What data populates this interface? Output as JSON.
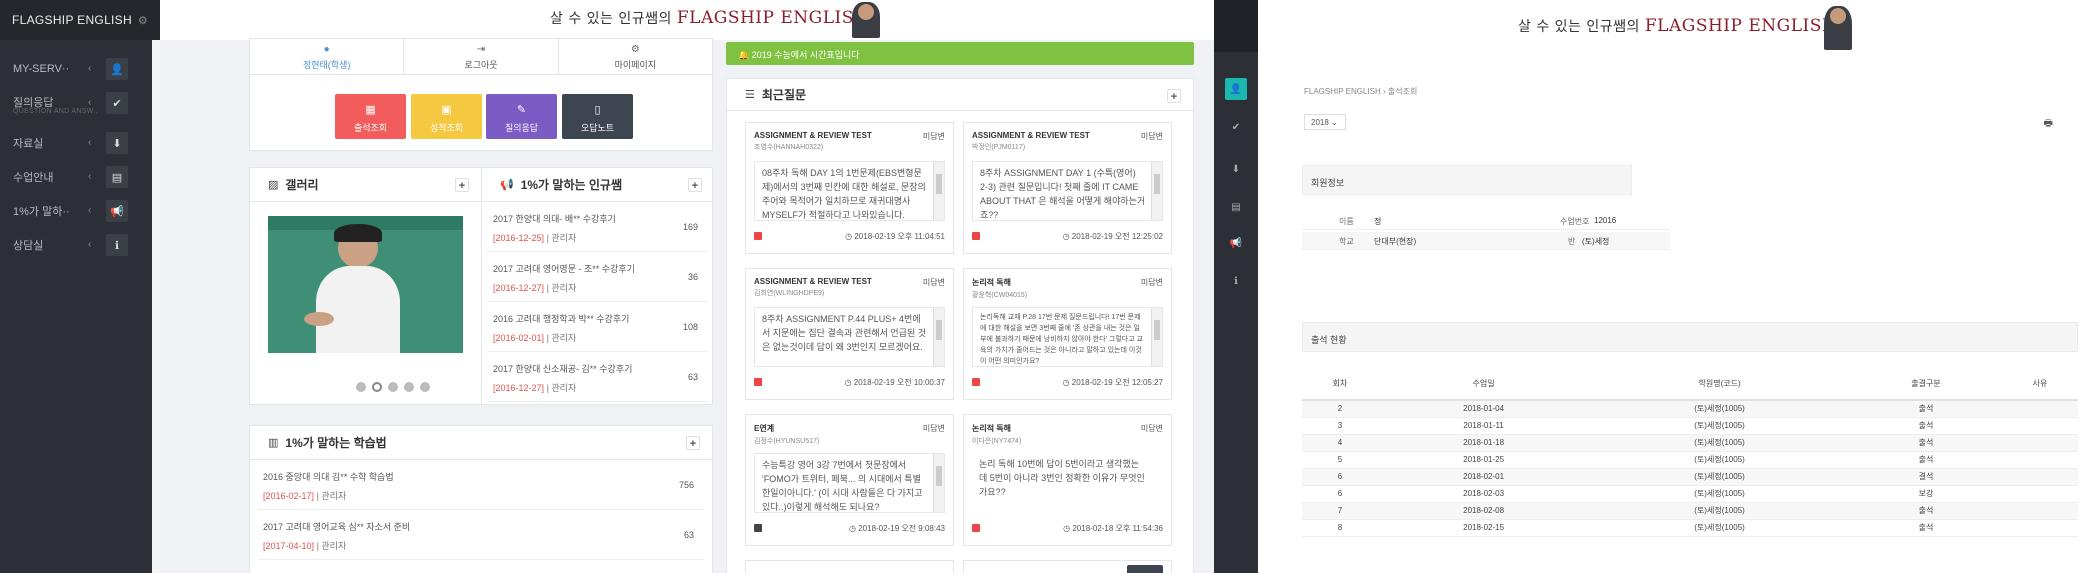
{
  "brand": {
    "name": "FLAGSHIP ENGLISH"
  },
  "banner": {
    "korean": "살 수 있는 인규쌤의",
    "english": "FLAGSHIP ENGLISH"
  },
  "sidebar": {
    "items": [
      {
        "label": "MY-SERV··",
        "icon": "user-icon"
      },
      {
        "label": "질의응답",
        "sub": "QUESTION AND ANSW..",
        "icon": "check-icon"
      },
      {
        "label": "자료실",
        "icon": "download-icon"
      },
      {
        "label": "수업안내",
        "icon": "book-icon"
      },
      {
        "label": "1%가 말하··",
        "icon": "megaphone-icon"
      },
      {
        "label": "상담실",
        "icon": "info-icon"
      }
    ]
  },
  "user_tabs": [
    {
      "label": "정현태(학생)",
      "icon": "user-icon"
    },
    {
      "label": "로그아웃",
      "icon": "logout-icon"
    },
    {
      "label": "마이페이지",
      "icon": "gear-icon"
    }
  ],
  "quick_buttons": [
    {
      "label": "출석조회",
      "color": "#f25c5c"
    },
    {
      "label": "성적조회",
      "color": "#f5c842"
    },
    {
      "label": "질의응답",
      "color": "#7b5bc4"
    },
    {
      "label": "오답노트",
      "color": "#3d4650"
    }
  ],
  "gallery": {
    "title": "갤러리"
  },
  "secret": {
    "title": "1%가 말하는 인규쌤",
    "items": [
      {
        "title": "2017 한양대 의대- 배** 수강후기",
        "date": "[2016-12-25]",
        "author": "| 관리자",
        "count": "169"
      },
      {
        "title": "2017 고려대 영어영문 - 조** 수강후기",
        "date": "[2016-12-27]",
        "author": "| 관리자",
        "count": "36"
      },
      {
        "title": "2016 고려대 행정학과 박** 수강후기",
        "date": "[2016-02-01]",
        "author": "| 관리자",
        "count": "108"
      },
      {
        "title": "2017 한양대 신소재공- 김** 수강후기",
        "date": "[2016-12-27]",
        "author": "| 관리자",
        "count": "63"
      }
    ]
  },
  "study": {
    "title": "1%가 말하는 학습법",
    "items": [
      {
        "title": "2016 중앙대 의대 김** 수학 학습법",
        "date": "[2016-02-17]",
        "author": "| 관리자",
        "count": "756"
      },
      {
        "title": "2017 고려대 영어교육 심** 자소서 준비",
        "date": "[2017-04-10]",
        "author": "| 관리자",
        "count": "63"
      }
    ]
  },
  "alert": {
    "text": "2019 수능에서 시간표입니다"
  },
  "recent_qna": {
    "title": "최근질문",
    "cards": [
      {
        "title": "ASSIGNMENT & REVIEW TEST",
        "author": "조영수(HANNAH0322)",
        "badge": "미답변",
        "body": "08주차 독해 DAY 1의 1번문제(EBS변형문제)에서의 3번째 민칸에 대한 해설로, 문장의 주어와 목적어가 일치하므로 재귀대명사 MYSELF가 적절하다고 나와있습니다.",
        "time": "2018-02-19 오후 11:04:51",
        "locked": true
      },
      {
        "title": "ASSIGNMENT & REVIEW TEST",
        "author": "박정인(PJM0117)",
        "badge": "미답변",
        "body": "8주차 ASSIGNMENT DAY 1 (수특(영어) 2-3) 관련 질문입니다! 첫째 줄에 IT CAME ABOUT THAT 은 해석을 어떻게 해야하는거죠??",
        "time": "2018-02-19 오전 12:25:02",
        "locked": true
      },
      {
        "title": "ASSIGNMENT & REVIEW TEST",
        "author": "김희연(WLINGHDPE9)",
        "badge": "미답변",
        "body": "8주차 ASSIGNMENT P.44 PLUS+ 4번에서 지문에는 집단 결속과 관련해서 언급된 것은 없는것이데 답이 왜 3번인지 모르겠어요.",
        "time": "2018-02-19 오전 10:00:37",
        "locked": true
      },
      {
        "title": "논리적 독해",
        "author": "황윤혁(CW04015)",
        "badge": "미답변",
        "body": "논리독해 교재 P.28 17번 문제 질문드립니다! 17번 문제에 대한 해설을 보면 3번째 줄에 '존 상관을 내는 것은 일부에 불과하기 때문에 낭비하지 않아야 한다' 그렇다고 교육의 가치가 줄어드는 것은 아니라고 말하고 있는데 이것이 어떤 의미인가요?",
        "time": "2018-02-19 오전 12:05:27",
        "locked": true
      },
      {
        "title": "E연계",
        "author": "김정수(HYUNSU517)",
        "badge": "미답변",
        "body": "수능특강 영어 3강 7번에서 첫문장에서 'FOMO가 트위터, 페북... 의 시대에서 특별한일이아니다.' (이 시대 사람들은 다 가지고 있다..)이렇게 해석해도 되나요?",
        "time": "2018-02-19 오전 9:08:43",
        "locked": false
      },
      {
        "title": "논리적 독해",
        "author": "이다은(NY7474)",
        "badge": "미답변",
        "body": "논리 독해 10번에 답이 5번이라고 생각했는데 5번이 아니라 3번인 정확한 이유가 무엇인가요??",
        "time": "2018-02-18 오후 11:54:36",
        "locked": true
      }
    ]
  },
  "page2": {
    "breadcrumb_home": "FLAGSHIP ENGLISH",
    "breadcrumb_sep": "›",
    "breadcrumb_current": "출석조회",
    "year": "2018",
    "member_section": "회원정보",
    "member": {
      "name_label": "이름",
      "name_value": "정",
      "no_label": "수업번호",
      "no_value": "12016",
      "school_label": "학교",
      "school_value": "단대부(현장)",
      "class_label": "반",
      "class_value": "(토)세정"
    },
    "attendance_section": "출석 현황",
    "table": {
      "headers": [
        "회차",
        "수업일",
        "학원명(코드)",
        "출결구분",
        "사유"
      ],
      "rows": [
        [
          "2",
          "2018-01-04",
          "(토)세정(1005)",
          "출석",
          ""
        ],
        [
          "3",
          "2018-01-11",
          "(토)세정(1005)",
          "출석",
          ""
        ],
        [
          "4",
          "2018-01-18",
          "(토)세정(1005)",
          "출석",
          ""
        ],
        [
          "5",
          "2018-01-25",
          "(토)세정(1005)",
          "출석",
          ""
        ],
        [
          "6",
          "2018-02-01",
          "(토)세정(1005)",
          "결석",
          ""
        ],
        [
          "6",
          "2018-02-03",
          "(토)세정(1005)",
          "보강",
          ""
        ],
        [
          "7",
          "2018-02-08",
          "(토)세정(1005)",
          "출석",
          ""
        ],
        [
          "8",
          "2018-02-15",
          "(토)세정(1005)",
          "출석",
          ""
        ]
      ]
    }
  }
}
